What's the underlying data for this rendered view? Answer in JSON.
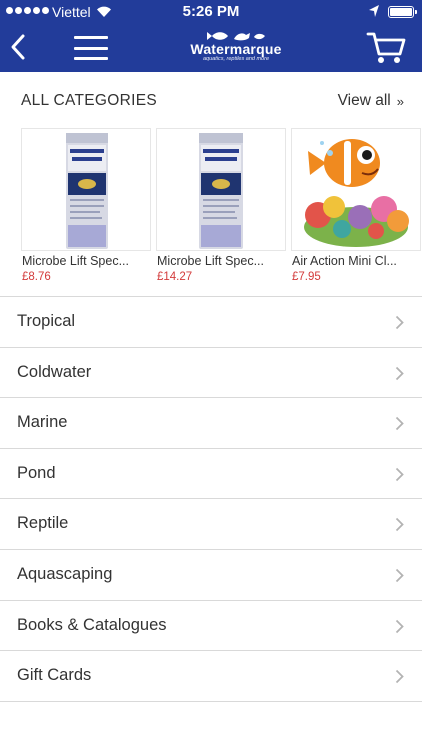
{
  "status_bar": {
    "carrier": "Viettel",
    "time": "5:26 PM"
  },
  "header": {
    "brand": "Watermarque",
    "tagline": "aquatics, reptiles and more",
    "icons": [
      "back-icon",
      "menu-icon",
      "cart-icon"
    ],
    "color": "#223c9a"
  },
  "categories_section": {
    "title": "ALL CATEGORIES",
    "view_all": "View all",
    "view_all_arrow": "»"
  },
  "products": [
    {
      "name": "Microbe Lift Spec...",
      "price": "£8.76"
    },
    {
      "name": "Microbe Lift Spec...",
      "price": "£14.27"
    },
    {
      "name": "Air Action Mini Cl...",
      "price": "£7.95"
    }
  ],
  "category_list": [
    "Tropical",
    "Coldwater",
    "Marine",
    "Pond",
    "Reptile",
    "Aquascaping",
    "Books & Catalogues",
    "Gift Cards"
  ],
  "colors": {
    "price": "#d33b3b",
    "divider": "#d9d9d9"
  }
}
